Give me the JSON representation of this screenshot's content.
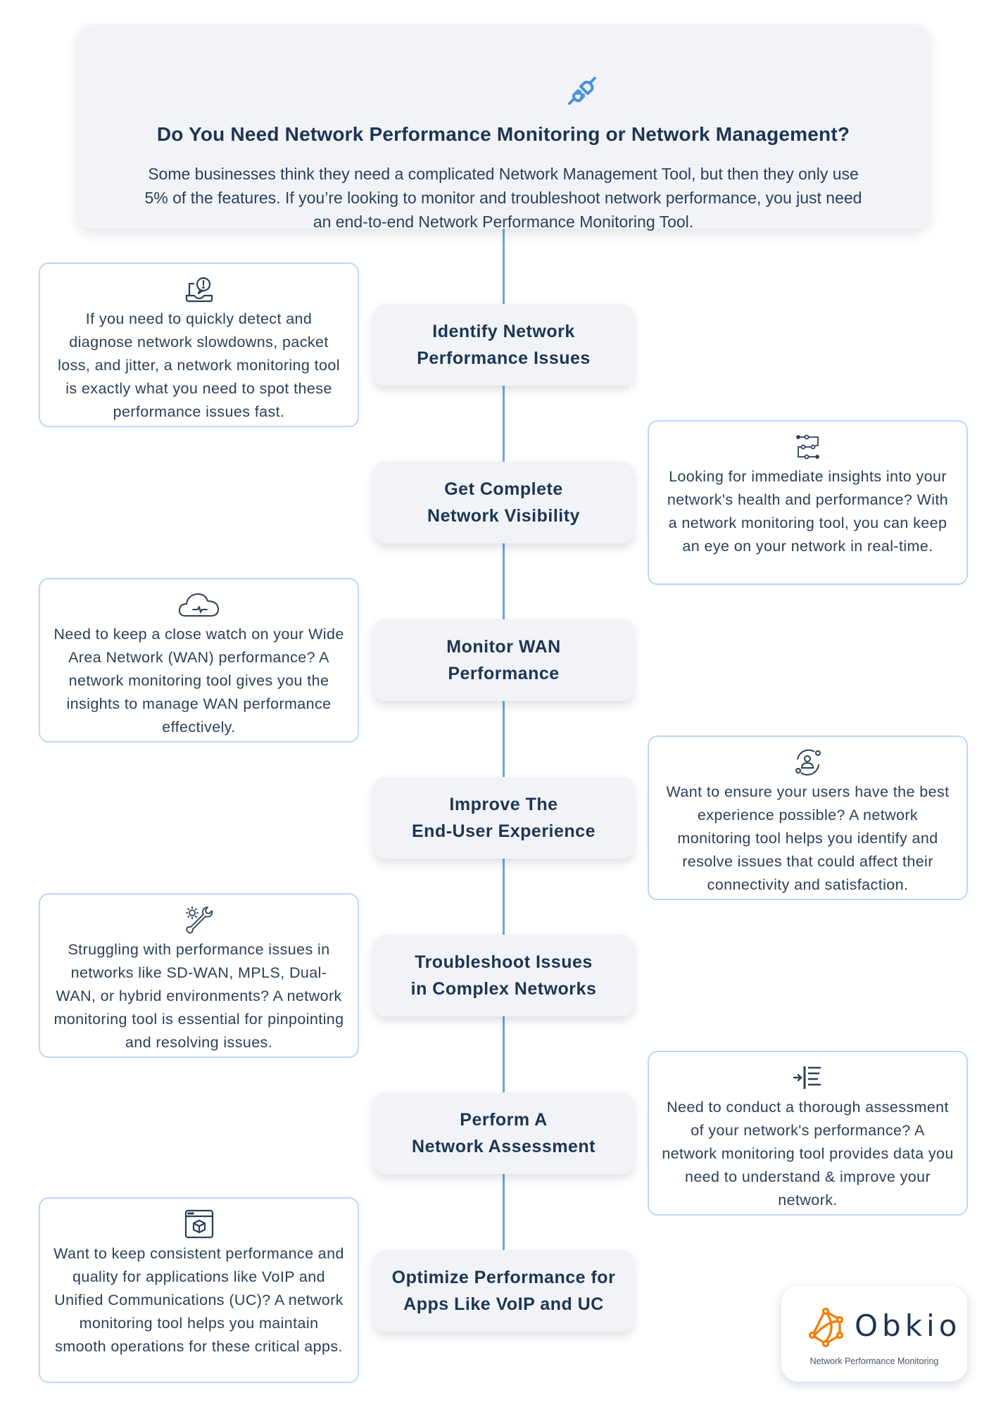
{
  "header": {
    "icon": "plug-icon",
    "title": "Do You Need Network Performance Monitoring or Network Management?",
    "description": "Some businesses think they need a complicated Network Management Tool, but then they only use 5% of the features. If you’re looking to monitor and troubleshoot network performance, you just need an end-to-end Network Performance Monitoring Tool."
  },
  "steps": [
    {
      "label": "Identify Network Performance Issues",
      "line1": "Identify Network",
      "line2": "Performance Issues",
      "card_side": "left",
      "card_icon": "laptop-alert-icon",
      "card_text": "If you need to quickly detect and diagnose network slowdowns, packet loss, and jitter, a network monitoring tool is exactly what you need to spot these performance issues fast."
    },
    {
      "label": "Get Complete Network Visibility",
      "line1": "Get Complete",
      "line2": "Network Visibility",
      "card_side": "right",
      "card_icon": "network-nodes-icon",
      "card_text": "Looking for immediate insights into your network's health and performance? With a network monitoring tool, you can keep an eye on your network in real-time."
    },
    {
      "label": "Monitor WAN Performance",
      "line1": "Monitor WAN",
      "line2": "Performance",
      "card_side": "left",
      "card_icon": "cloud-pulse-icon",
      "card_text": "Need to keep a close watch on your Wide Area Network (WAN) performance? A network monitoring tool gives you the insights to manage WAN performance effectively."
    },
    {
      "label": "Improve The End-User Experience",
      "line1": "Improve The",
      "line2": "End-User Experience",
      "card_side": "right",
      "card_icon": "user-cycle-icon",
      "card_text": "Want to ensure your users have the best experience possible? A network monitoring tool helps you identify and resolve issues that could affect their connectivity and satisfaction."
    },
    {
      "label": "Troubleshoot Issues in Complex Networks",
      "line1": "Troubleshoot Issues",
      "line2": "in Complex Networks",
      "card_side": "left",
      "card_icon": "gear-wrench-icon",
      "card_text": "Struggling with performance issues in networks like SD-WAN, MPLS, Dual-WAN, or hybrid environments? A network monitoring tool is essential for pinpointing and resolving issues."
    },
    {
      "label": "Perform A Network Assessment",
      "line1": "Perform A",
      "line2": "Network Assessment",
      "card_side": "right",
      "card_icon": "indent-list-icon",
      "card_text": "Need to conduct a thorough assessment of your network's performance? A network monitoring tool provides data you need to understand & improve your network."
    },
    {
      "label": "Optimize Performance for Apps Like VoIP and UC",
      "line1": "Optimize Performance for",
      "line2": "Apps Like VoIP and UC",
      "card_side": "left",
      "card_icon": "app-window-cube-icon",
      "card_text": "Want to keep consistent performance and quality for applications like VoIP and Unified Communications (UC)? A network monitoring tool helps you maintain smooth operations for these critical apps."
    }
  ],
  "logo": {
    "brand": "Obkio",
    "tagline": "Network Performance Monitoring"
  },
  "colors": {
    "accent_blue": "#4a90e2",
    "connector": "#6aa6ea",
    "card_border": "#bcd7f5",
    "text_dark": "#1c3553",
    "panel_bg": "#f1f3f7",
    "logo_orange": "#f57c00"
  }
}
